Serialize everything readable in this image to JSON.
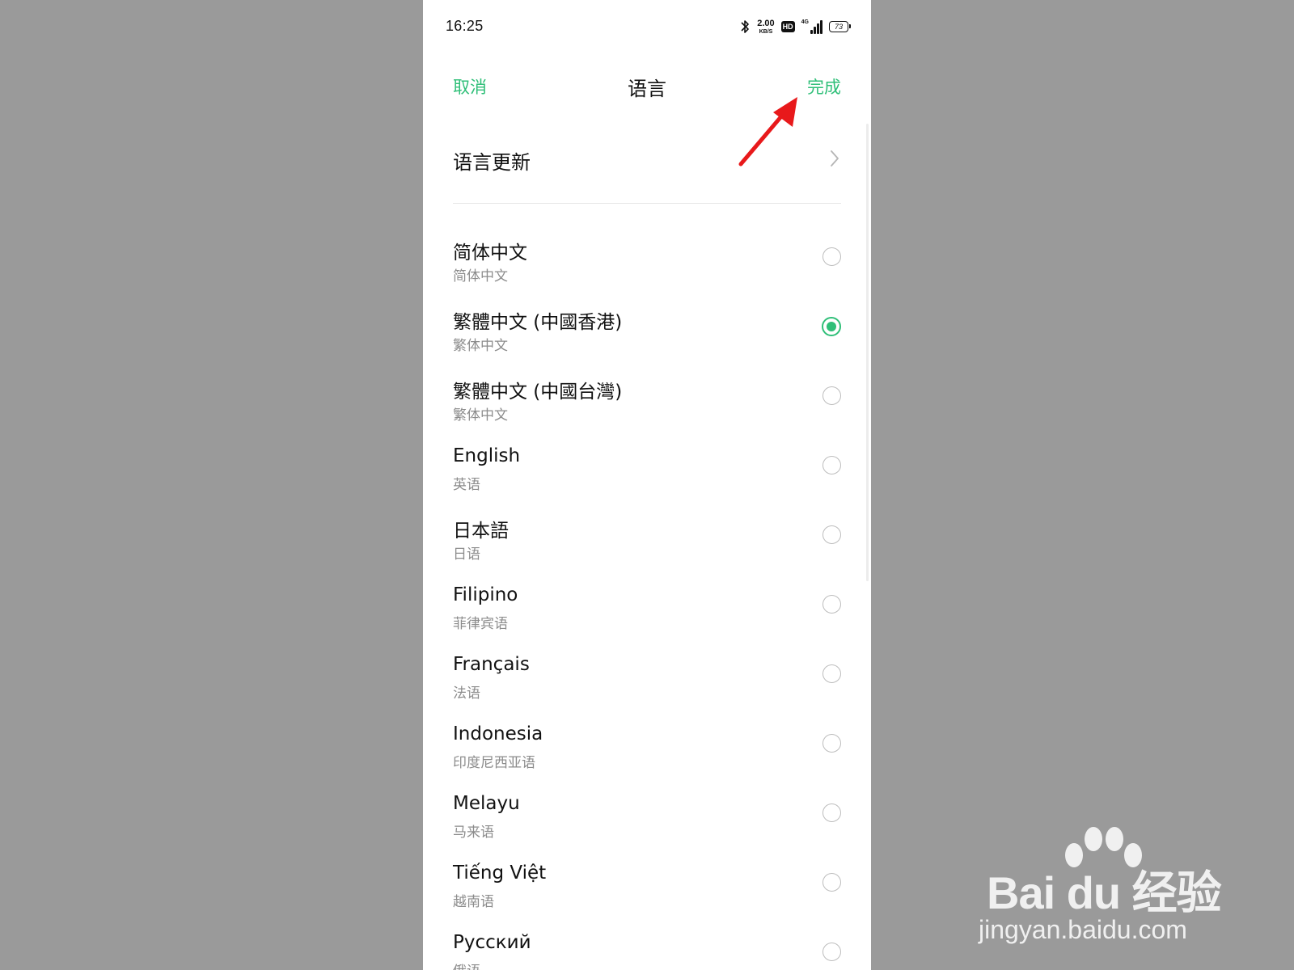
{
  "status_bar": {
    "time": "16:25",
    "net_speed_value": "2.00",
    "net_speed_unit": "KB/S",
    "hd_label": "HD",
    "network_type": "4G",
    "battery_level": "73",
    "icons": [
      "bluetooth-icon",
      "hd-icon",
      "signal-icon",
      "battery-icon"
    ]
  },
  "header": {
    "cancel_label": "取消",
    "title": "语言",
    "done_label": "完成"
  },
  "language_update": {
    "label": "语言更新"
  },
  "languages": [
    {
      "name": "简体中文",
      "sub": "简体中文",
      "selected": false
    },
    {
      "name": "繁體中文 (中國香港)",
      "sub": "繁体中文",
      "selected": true
    },
    {
      "name": "繁體中文 (中國台灣)",
      "sub": "繁体中文",
      "selected": false
    },
    {
      "name": "English",
      "sub": "英语",
      "selected": false
    },
    {
      "name": "日本語",
      "sub": "日语",
      "selected": false
    },
    {
      "name": "Filipino",
      "sub": "菲律宾语",
      "selected": false
    },
    {
      "name": "Français",
      "sub": "法语",
      "selected": false
    },
    {
      "name": "Indonesia",
      "sub": "印度尼西亚语",
      "selected": false
    },
    {
      "name": "Melayu",
      "sub": "马来语",
      "selected": false
    },
    {
      "name": "Tiếng Việt",
      "sub": "越南语",
      "selected": false
    },
    {
      "name": "Русский",
      "sub": "俄语",
      "selected": false
    }
  ],
  "watermark": {
    "logo_text": "Bai du 经验",
    "url": "jingyan.baidu.com"
  },
  "colors": {
    "accent": "#2fbf78",
    "background": "#9a9a9a",
    "annotation_arrow": "#e8191b"
  }
}
